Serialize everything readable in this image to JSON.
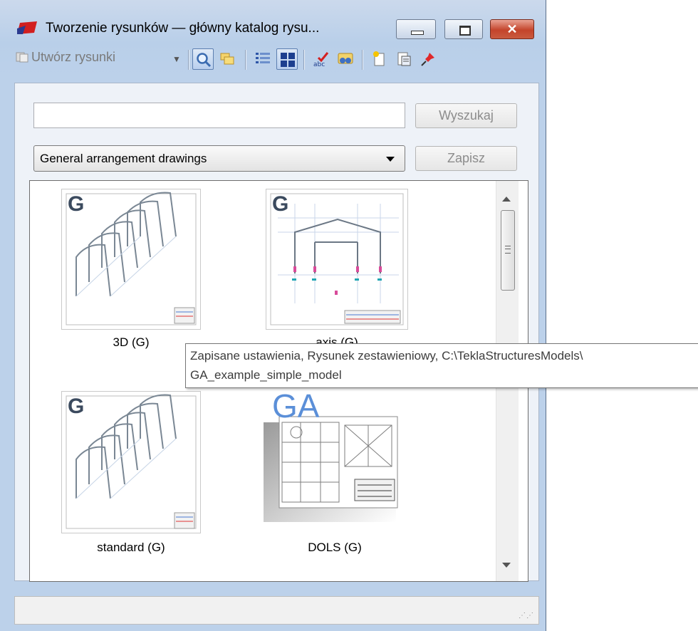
{
  "window": {
    "title": "Tworzenie rysunków — główny katalog rysu..."
  },
  "toolbar": {
    "create_label": "Utwórz rysunki"
  },
  "search": {
    "value": "",
    "button_label": "Wyszukaj"
  },
  "filter": {
    "selected": "General arrangement drawings",
    "save_label": "Zapisz"
  },
  "items": [
    {
      "caption": "3D (G)",
      "badge": "G"
    },
    {
      "caption": "axis (G)",
      "badge": "G"
    },
    {
      "caption": "standard (G)",
      "badge": "G"
    },
    {
      "caption": "DOLS (G)",
      "badge": "GA"
    }
  ],
  "tooltip": {
    "line1": "Zapisane ustawienia, Rysunek zestawieniowy, C:\\TeklaStructuresModels\\",
    "line2": "GA_example_simple_model"
  },
  "colors": {
    "window_bg": "#bcd1ea",
    "close_button": "#c4442b",
    "badge_blue": "#5b8fd8"
  }
}
